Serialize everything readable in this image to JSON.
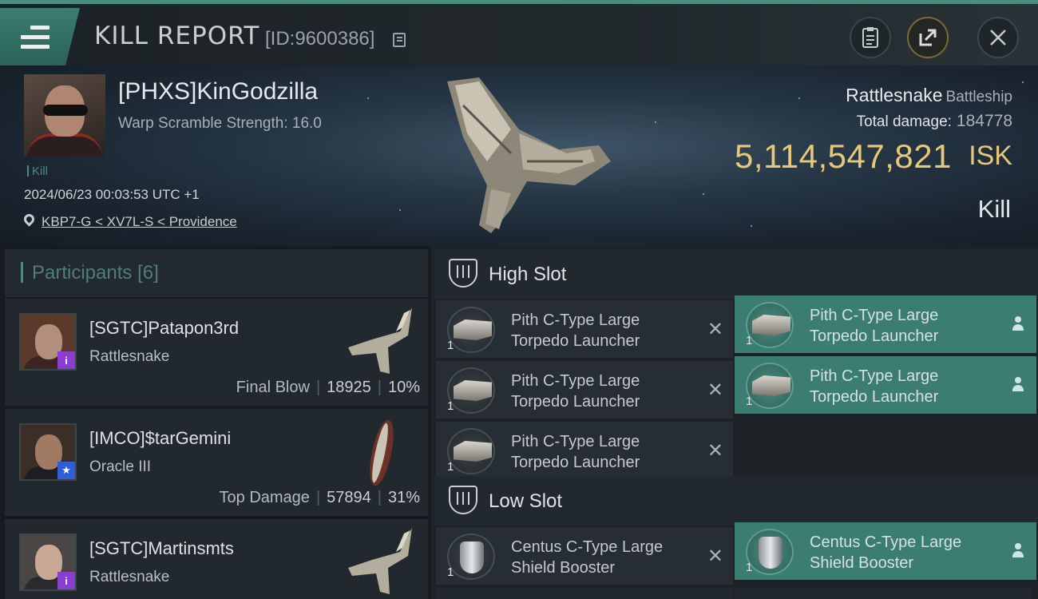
{
  "header": {
    "title": "KILL REPORT",
    "report_id": "[ID:9600386]",
    "icons": [
      "menu-icon",
      "copy-icon",
      "clipboard-icon",
      "share-icon",
      "close-icon"
    ]
  },
  "victim": {
    "name": "[PHXS]KinGodzilla",
    "warp_scramble": "Warp Scramble Strength: 16.0",
    "kill_tag": "Kill",
    "datetime": "2024/06/23 00:03:53 UTC +1",
    "location": "KBP7-G < XV7L-S < Providence",
    "ship": "Rattlesnake",
    "ship_class": "Battleship",
    "total_damage_label": "Total damage:",
    "total_damage": "184778",
    "isk_value": "5,114,547,821",
    "isk_currency": "ISK",
    "result": "Kill"
  },
  "participants": {
    "label": "Participants",
    "count": "[6]",
    "rows": [
      {
        "name": "[SGTC]Patapon3rd",
        "ship": "Rattlesnake",
        "stat_label": "Final Blow",
        "damage": "18925",
        "percent": "10%",
        "badge": "i"
      },
      {
        "name": "[IMCO]$tarGemini",
        "ship": "Oracle III",
        "stat_label": "Top Damage",
        "damage": "57894",
        "percent": "31%",
        "badge": "★"
      },
      {
        "name": "[SGTC]Martinsmts",
        "ship": "Rattlesnake",
        "stat_label": "",
        "damage": "",
        "percent": "",
        "badge": "i"
      }
    ]
  },
  "modules": {
    "high_slot_label": "High Slot",
    "low_slot_label": "Low Slot",
    "high": [
      {
        "name": "Pith C-Type Large Torpedo Launcher",
        "qty": "1",
        "state": "destroyed"
      },
      {
        "name": "Pith C-Type Large Torpedo Launcher",
        "qty": "1",
        "state": "dropped"
      },
      {
        "name": "Pith C-Type Large Torpedo Launcher",
        "qty": "1",
        "state": "destroyed"
      },
      {
        "name": "Pith C-Type Large Torpedo Launcher",
        "qty": "1",
        "state": "dropped"
      },
      {
        "name": "Pith C-Type Large Torpedo Launcher",
        "qty": "1",
        "state": "destroyed"
      }
    ],
    "low": [
      {
        "name": "Centus C-Type Large Shield Booster",
        "qty": "1",
        "state": "destroyed"
      },
      {
        "name": "Centus C-Type Large Shield Booster",
        "qty": "1",
        "state": "dropped"
      }
    ],
    "destroyed_mark": "✕"
  },
  "colors": {
    "accent_teal": "#3b7d72",
    "isk_gold": "#e6c878",
    "badge_purple": "#8a3ed0",
    "badge_blue": "#2f5ed8"
  }
}
